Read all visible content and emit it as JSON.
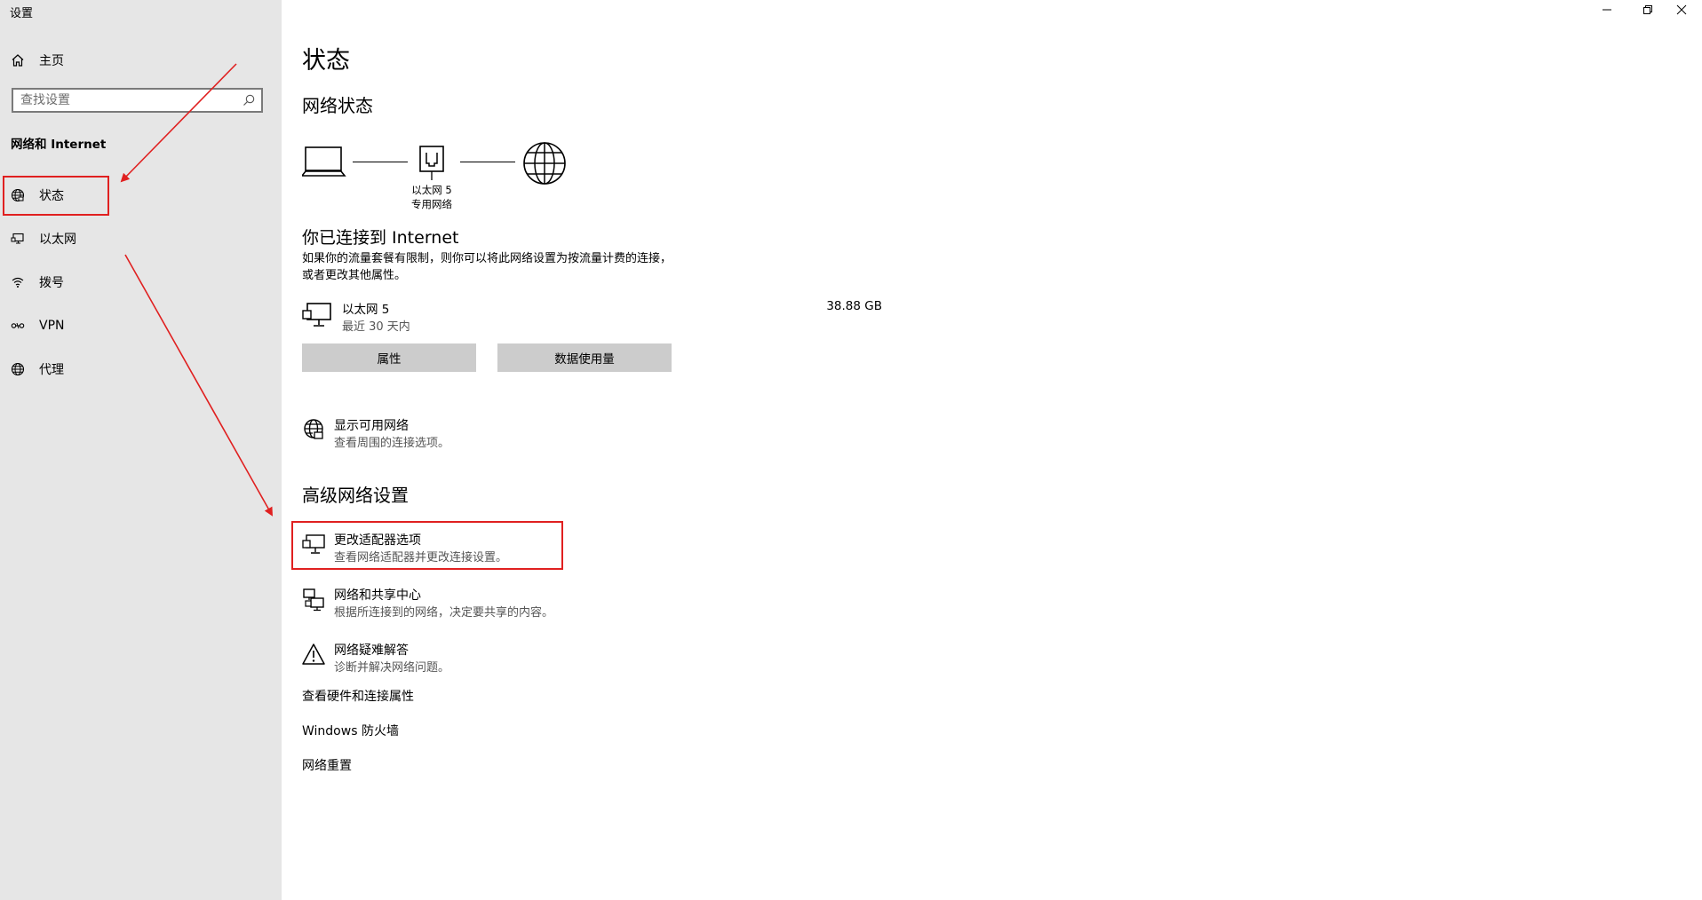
{
  "window": {
    "title": "设置",
    "minimize_icon": "minimize-icon",
    "restore_icon": "restore-icon",
    "close_icon": "close-icon"
  },
  "sidebar": {
    "home": {
      "label": "主页",
      "icon": "home-icon"
    },
    "search": {
      "placeholder": "查找设置",
      "icon": "search-icon"
    },
    "section_title": "网络和 Internet",
    "items": [
      {
        "label": "状态",
        "icon": "status-globe-icon",
        "selected": true
      },
      {
        "label": "以太网",
        "icon": "ethernet-icon"
      },
      {
        "label": "拨号",
        "icon": "dialup-icon"
      },
      {
        "label": "VPN",
        "icon": "vpn-icon"
      },
      {
        "label": "代理",
        "icon": "proxy-globe-icon"
      }
    ]
  },
  "main": {
    "title": "状态",
    "network_status_heading": "网络状态",
    "diagram": {
      "computer_icon": "laptop-icon",
      "adapter_icon": "ethernet-port-icon",
      "internet_icon": "globe-icon",
      "adapter_label": "以太网 5",
      "network_type": "专用网络"
    },
    "connected_title": "你已连接到 Internet",
    "connected_desc": "如果你的流量套餐有限制，则你可以将此网络设置为按流量计费的连接，或者更改其他属性。",
    "adapter": {
      "icon": "wired-pc-icon",
      "name": "以太网 5",
      "period": "最近 30 天内",
      "usage": "38.88 GB"
    },
    "buttons": {
      "properties": "属性",
      "data_usage": "数据使用量"
    },
    "show_networks": {
      "icon": "available-networks-icon",
      "title": "显示可用网络",
      "subtitle": "查看周围的连接选项。"
    },
    "advanced_heading": "高级网络设置",
    "advanced_items": [
      {
        "icon": "adapter-options-icon",
        "title": "更改适配器选项",
        "subtitle": "查看网络适配器并更改连接设置。"
      },
      {
        "icon": "sharing-center-icon",
        "title": "网络和共享中心",
        "subtitle": "根据所连接到的网络，决定要共享的内容。"
      },
      {
        "icon": "warning-icon",
        "title": "网络疑难解答",
        "subtitle": "诊断并解决网络问题。"
      }
    ],
    "links": [
      "查看硬件和连接属性",
      "Windows 防火墙",
      "网络重置"
    ]
  },
  "colors": {
    "sidebar_bg": "#e6e6e6",
    "button_bg": "#cccccc",
    "annotation_red": "#e02020"
  }
}
